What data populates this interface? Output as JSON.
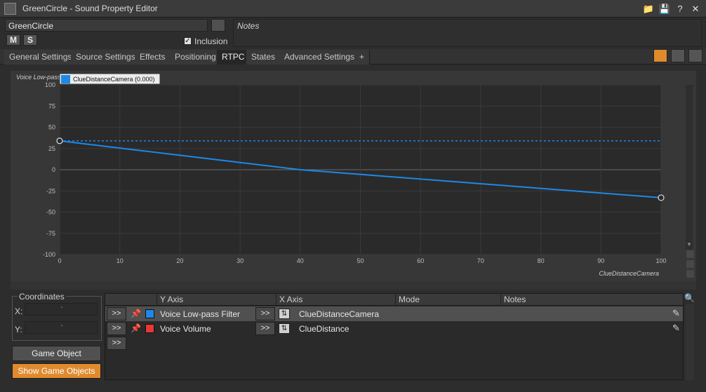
{
  "window": {
    "title": "GreenCircle - Sound Property Editor",
    "buttons": [
      "folder-icon",
      "save-icon",
      "help-icon",
      "close-icon"
    ]
  },
  "object": {
    "name": "GreenCircle",
    "mute_label": "M",
    "solo_label": "S",
    "inclusion_label": "Inclusion",
    "inclusion_checked": true
  },
  "notes": {
    "label": "Notes"
  },
  "tabs": [
    {
      "label": "General Settings"
    },
    {
      "label": "Source Settings"
    },
    {
      "label": "Effects"
    },
    {
      "label": "Positioning"
    },
    {
      "label": "RTPC",
      "active": true
    },
    {
      "label": "States"
    },
    {
      "label": "Advanced Settings"
    },
    {
      "label": "+"
    }
  ],
  "graph": {
    "y_label": "Voice Low-pass",
    "legend": "ClueDistanceCamera (0.000)",
    "x_label": "ClueDistanceCamera",
    "accent": "#1e88e5"
  },
  "chart_data": {
    "type": "line",
    "xlim": [
      0,
      100
    ],
    "ylim": [
      -100,
      100
    ],
    "x_ticks": [
      "0",
      "10",
      "20",
      "30",
      "40",
      "50",
      "60",
      "70",
      "80",
      "90",
      "100"
    ],
    "y_ticks": [
      "100",
      "75",
      "50",
      "25",
      "0",
      "-25",
      "-50",
      "-75",
      "-100"
    ],
    "series": [
      {
        "x": [
          0,
          40,
          100
        ],
        "y": [
          34,
          0,
          -33
        ]
      }
    ],
    "current_value_line": 34,
    "grid": true
  },
  "coordinates": {
    "title": "Coordinates",
    "x_label": "X:",
    "y_label": "Y:",
    "x_value": "-",
    "y_value": "-"
  },
  "buttons": {
    "game_object_explorer": "Game Object Explorer...",
    "show_game_objects": "Show Game Objects"
  },
  "rtpc_list": {
    "columns": [
      "Y Axis",
      "X Axis",
      "Mode",
      "Notes"
    ],
    "rows": [
      {
        "arrow": ">>",
        "y_axis": "Voice Low-pass Filter",
        "y_color": "#1e88e5",
        "x_arrow": ">>",
        "x_axis": "ClueDistanceCamera",
        "selected": true
      },
      {
        "arrow": ">>",
        "y_axis": "Voice Volume",
        "y_color": "#e53935",
        "x_arrow": ">>",
        "x_axis": "ClueDistance",
        "selected": false
      },
      {
        "arrow": ">>"
      }
    ]
  }
}
